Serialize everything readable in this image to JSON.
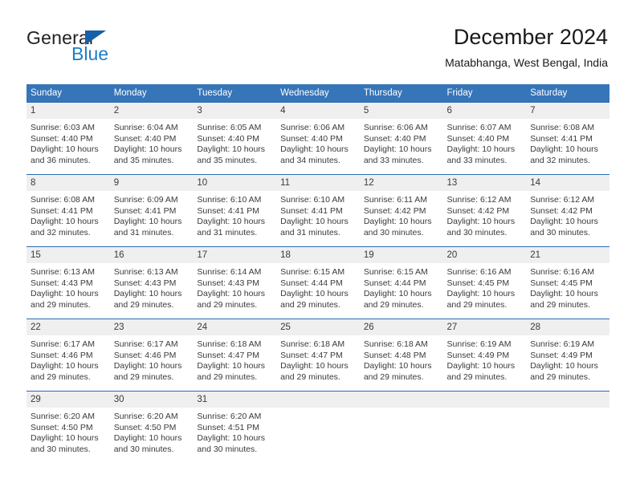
{
  "brand": {
    "name_part1": "General",
    "name_part2": "Blue",
    "triangle_color": "#1560a8",
    "blue_color": "#1d7dc4"
  },
  "header": {
    "title": "December 2024",
    "location": "Matabhanga, West Bengal, India"
  },
  "theme": {
    "header_blue": "#3575b8",
    "row_border_blue": "#2c6cb0",
    "daynum_band": "#efeff0",
    "text": "#3a3a3a"
  },
  "weekdays": [
    "Sunday",
    "Monday",
    "Tuesday",
    "Wednesday",
    "Thursday",
    "Friday",
    "Saturday"
  ],
  "weeks": [
    [
      {
        "day": "1",
        "sunrise": "Sunrise: 6:03 AM",
        "sunset": "Sunset: 4:40 PM",
        "daylight1": "Daylight: 10 hours",
        "daylight2": "and 36 minutes."
      },
      {
        "day": "2",
        "sunrise": "Sunrise: 6:04 AM",
        "sunset": "Sunset: 4:40 PM",
        "daylight1": "Daylight: 10 hours",
        "daylight2": "and 35 minutes."
      },
      {
        "day": "3",
        "sunrise": "Sunrise: 6:05 AM",
        "sunset": "Sunset: 4:40 PM",
        "daylight1": "Daylight: 10 hours",
        "daylight2": "and 35 minutes."
      },
      {
        "day": "4",
        "sunrise": "Sunrise: 6:06 AM",
        "sunset": "Sunset: 4:40 PM",
        "daylight1": "Daylight: 10 hours",
        "daylight2": "and 34 minutes."
      },
      {
        "day": "5",
        "sunrise": "Sunrise: 6:06 AM",
        "sunset": "Sunset: 4:40 PM",
        "daylight1": "Daylight: 10 hours",
        "daylight2": "and 33 minutes."
      },
      {
        "day": "6",
        "sunrise": "Sunrise: 6:07 AM",
        "sunset": "Sunset: 4:40 PM",
        "daylight1": "Daylight: 10 hours",
        "daylight2": "and 33 minutes."
      },
      {
        "day": "7",
        "sunrise": "Sunrise: 6:08 AM",
        "sunset": "Sunset: 4:41 PM",
        "daylight1": "Daylight: 10 hours",
        "daylight2": "and 32 minutes."
      }
    ],
    [
      {
        "day": "8",
        "sunrise": "Sunrise: 6:08 AM",
        "sunset": "Sunset: 4:41 PM",
        "daylight1": "Daylight: 10 hours",
        "daylight2": "and 32 minutes."
      },
      {
        "day": "9",
        "sunrise": "Sunrise: 6:09 AM",
        "sunset": "Sunset: 4:41 PM",
        "daylight1": "Daylight: 10 hours",
        "daylight2": "and 31 minutes."
      },
      {
        "day": "10",
        "sunrise": "Sunrise: 6:10 AM",
        "sunset": "Sunset: 4:41 PM",
        "daylight1": "Daylight: 10 hours",
        "daylight2": "and 31 minutes."
      },
      {
        "day": "11",
        "sunrise": "Sunrise: 6:10 AM",
        "sunset": "Sunset: 4:41 PM",
        "daylight1": "Daylight: 10 hours",
        "daylight2": "and 31 minutes."
      },
      {
        "day": "12",
        "sunrise": "Sunrise: 6:11 AM",
        "sunset": "Sunset: 4:42 PM",
        "daylight1": "Daylight: 10 hours",
        "daylight2": "and 30 minutes."
      },
      {
        "day": "13",
        "sunrise": "Sunrise: 6:12 AM",
        "sunset": "Sunset: 4:42 PM",
        "daylight1": "Daylight: 10 hours",
        "daylight2": "and 30 minutes."
      },
      {
        "day": "14",
        "sunrise": "Sunrise: 6:12 AM",
        "sunset": "Sunset: 4:42 PM",
        "daylight1": "Daylight: 10 hours",
        "daylight2": "and 30 minutes."
      }
    ],
    [
      {
        "day": "15",
        "sunrise": "Sunrise: 6:13 AM",
        "sunset": "Sunset: 4:43 PM",
        "daylight1": "Daylight: 10 hours",
        "daylight2": "and 29 minutes."
      },
      {
        "day": "16",
        "sunrise": "Sunrise: 6:13 AM",
        "sunset": "Sunset: 4:43 PM",
        "daylight1": "Daylight: 10 hours",
        "daylight2": "and 29 minutes."
      },
      {
        "day": "17",
        "sunrise": "Sunrise: 6:14 AM",
        "sunset": "Sunset: 4:43 PM",
        "daylight1": "Daylight: 10 hours",
        "daylight2": "and 29 minutes."
      },
      {
        "day": "18",
        "sunrise": "Sunrise: 6:15 AM",
        "sunset": "Sunset: 4:44 PM",
        "daylight1": "Daylight: 10 hours",
        "daylight2": "and 29 minutes."
      },
      {
        "day": "19",
        "sunrise": "Sunrise: 6:15 AM",
        "sunset": "Sunset: 4:44 PM",
        "daylight1": "Daylight: 10 hours",
        "daylight2": "and 29 minutes."
      },
      {
        "day": "20",
        "sunrise": "Sunrise: 6:16 AM",
        "sunset": "Sunset: 4:45 PM",
        "daylight1": "Daylight: 10 hours",
        "daylight2": "and 29 minutes."
      },
      {
        "day": "21",
        "sunrise": "Sunrise: 6:16 AM",
        "sunset": "Sunset: 4:45 PM",
        "daylight1": "Daylight: 10 hours",
        "daylight2": "and 29 minutes."
      }
    ],
    [
      {
        "day": "22",
        "sunrise": "Sunrise: 6:17 AM",
        "sunset": "Sunset: 4:46 PM",
        "daylight1": "Daylight: 10 hours",
        "daylight2": "and 29 minutes."
      },
      {
        "day": "23",
        "sunrise": "Sunrise: 6:17 AM",
        "sunset": "Sunset: 4:46 PM",
        "daylight1": "Daylight: 10 hours",
        "daylight2": "and 29 minutes."
      },
      {
        "day": "24",
        "sunrise": "Sunrise: 6:18 AM",
        "sunset": "Sunset: 4:47 PM",
        "daylight1": "Daylight: 10 hours",
        "daylight2": "and 29 minutes."
      },
      {
        "day": "25",
        "sunrise": "Sunrise: 6:18 AM",
        "sunset": "Sunset: 4:47 PM",
        "daylight1": "Daylight: 10 hours",
        "daylight2": "and 29 minutes."
      },
      {
        "day": "26",
        "sunrise": "Sunrise: 6:18 AM",
        "sunset": "Sunset: 4:48 PM",
        "daylight1": "Daylight: 10 hours",
        "daylight2": "and 29 minutes."
      },
      {
        "day": "27",
        "sunrise": "Sunrise: 6:19 AM",
        "sunset": "Sunset: 4:49 PM",
        "daylight1": "Daylight: 10 hours",
        "daylight2": "and 29 minutes."
      },
      {
        "day": "28",
        "sunrise": "Sunrise: 6:19 AM",
        "sunset": "Sunset: 4:49 PM",
        "daylight1": "Daylight: 10 hours",
        "daylight2": "and 29 minutes."
      }
    ],
    [
      {
        "day": "29",
        "sunrise": "Sunrise: 6:20 AM",
        "sunset": "Sunset: 4:50 PM",
        "daylight1": "Daylight: 10 hours",
        "daylight2": "and 30 minutes."
      },
      {
        "day": "30",
        "sunrise": "Sunrise: 6:20 AM",
        "sunset": "Sunset: 4:50 PM",
        "daylight1": "Daylight: 10 hours",
        "daylight2": "and 30 minutes."
      },
      {
        "day": "31",
        "sunrise": "Sunrise: 6:20 AM",
        "sunset": "Sunset: 4:51 PM",
        "daylight1": "Daylight: 10 hours",
        "daylight2": "and 30 minutes."
      },
      {
        "day": "",
        "sunrise": "",
        "sunset": "",
        "daylight1": "",
        "daylight2": ""
      },
      {
        "day": "",
        "sunrise": "",
        "sunset": "",
        "daylight1": "",
        "daylight2": ""
      },
      {
        "day": "",
        "sunrise": "",
        "sunset": "",
        "daylight1": "",
        "daylight2": ""
      },
      {
        "day": "",
        "sunrise": "",
        "sunset": "",
        "daylight1": "",
        "daylight2": ""
      }
    ]
  ]
}
